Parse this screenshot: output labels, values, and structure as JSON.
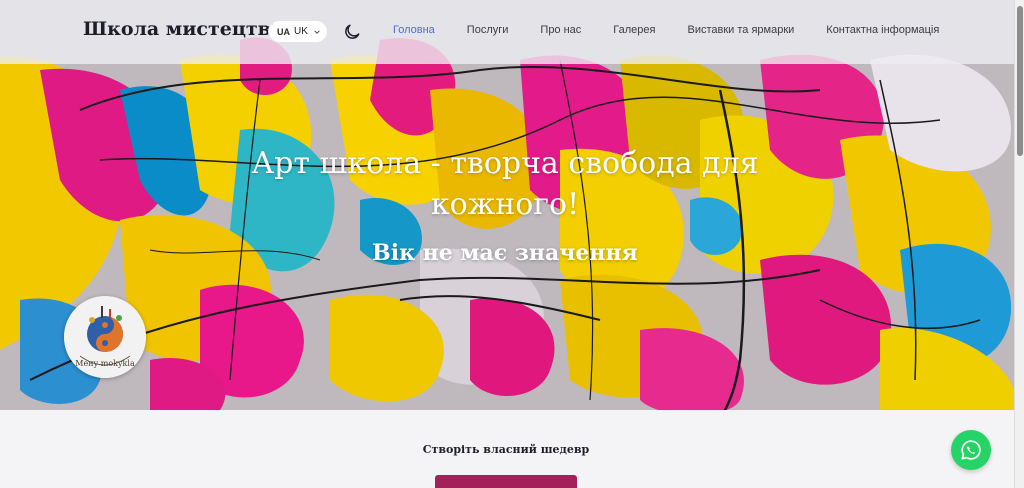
{
  "header": {
    "brand": "Школа мистецтв",
    "language": {
      "code": "UA",
      "selected": "UK"
    },
    "nav": [
      {
        "label": "Головна",
        "active": true
      },
      {
        "label": "Послуги",
        "active": false
      },
      {
        "label": "Про нас",
        "active": false
      },
      {
        "label": "Галерея",
        "active": false
      },
      {
        "label": "Виставки та ярмарки",
        "active": false
      },
      {
        "label": "Контактна інформація",
        "active": false
      }
    ]
  },
  "hero": {
    "title_line1": "Арт школа - творча свобода для",
    "title_line2": "кожного!",
    "subtitle": "Вік не має значення"
  },
  "logo": {
    "text": "Мену mokykla"
  },
  "main": {
    "create_text": "Створіть власний шедевр",
    "cta_label": ""
  },
  "colors": {
    "accent_nav": "#4a6fd6",
    "cta": "#a3205b",
    "whatsapp": "#25d366"
  },
  "icons": {
    "theme_toggle": "moon-icon",
    "language_dropdown": "chevron-down-icon",
    "chat": "whatsapp-icon"
  }
}
